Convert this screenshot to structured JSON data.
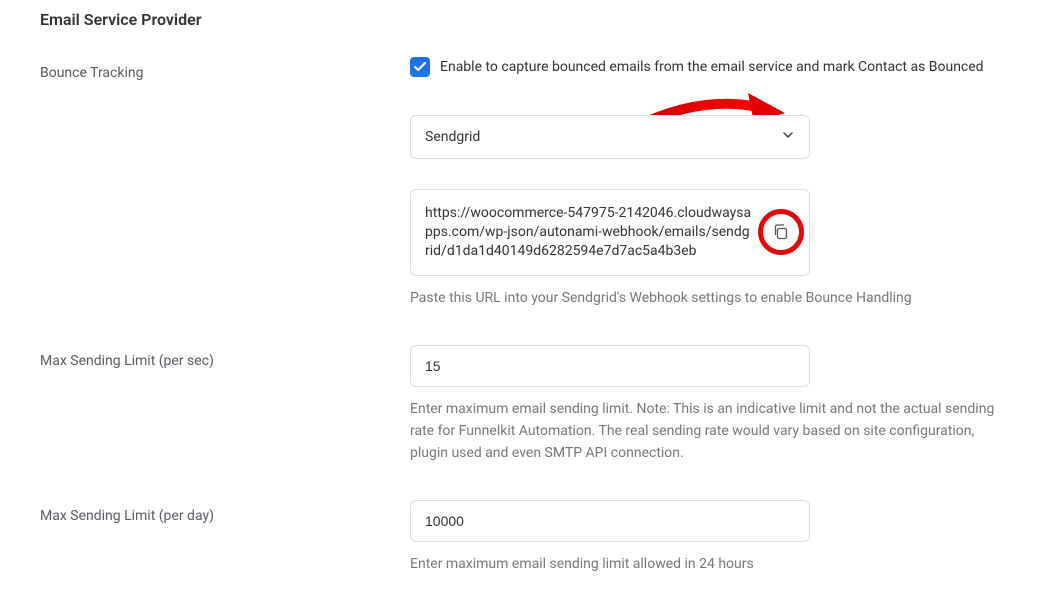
{
  "section_title": "Email Service Provider",
  "bounce_tracking": {
    "label": "Bounce Tracking",
    "checkbox_label": "Enable to capture bounced emails from the email service and mark Contact as Bounced",
    "checked": true,
    "provider_selected": "Sendgrid",
    "webhook_url": "https://woocommerce-547975-2142046.cloudwaysapps.com/wp-json/autonami-webhook/emails/sendgrid/d1da1d40149d6282594e7d7ac5a4b3eb",
    "webhook_help": "Paste this URL into your Sendgrid's Webhook settings to enable Bounce Handling"
  },
  "max_sending_per_sec": {
    "label": "Max Sending Limit (per sec)",
    "value": "15",
    "help": "Enter maximum email sending limit. Note: This is an indicative limit and not the actual sending rate for Funnelkit Automation. The real sending rate would vary based on site configuration, plugin used and even SMTP API connection."
  },
  "max_sending_per_day": {
    "label": "Max Sending Limit (per day)",
    "value": "10000",
    "help": "Enter maximum email sending limit allowed in 24 hours"
  }
}
